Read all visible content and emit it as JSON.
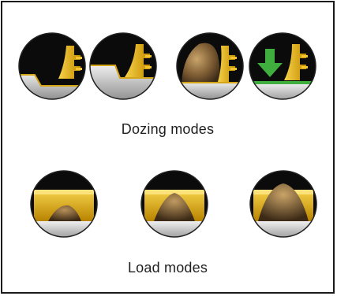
{
  "dozing": {
    "caption": "Dozing modes",
    "modes": [
      {
        "icon": "dozer-blade-dig-step-icon",
        "active": false
      },
      {
        "icon": "dozer-blade-flat-step-icon",
        "active": false
      },
      {
        "icon": "dozer-blade-rock-pile-icon",
        "active": false
      },
      {
        "icon": "dozer-blade-push-down-arrow-icon",
        "active": false
      }
    ]
  },
  "load": {
    "caption": "Load modes",
    "modes": [
      {
        "icon": "bucket-load-low-icon",
        "level": "low"
      },
      {
        "icon": "bucket-load-medium-icon",
        "level": "medium"
      },
      {
        "icon": "bucket-load-high-icon",
        "level": "high"
      }
    ]
  },
  "colors": {
    "blade_yellow": "#e8b410",
    "button_black": "#0d0d0d",
    "ground_grey": "#c9c9c9",
    "arrow_green": "#3fae3f"
  }
}
